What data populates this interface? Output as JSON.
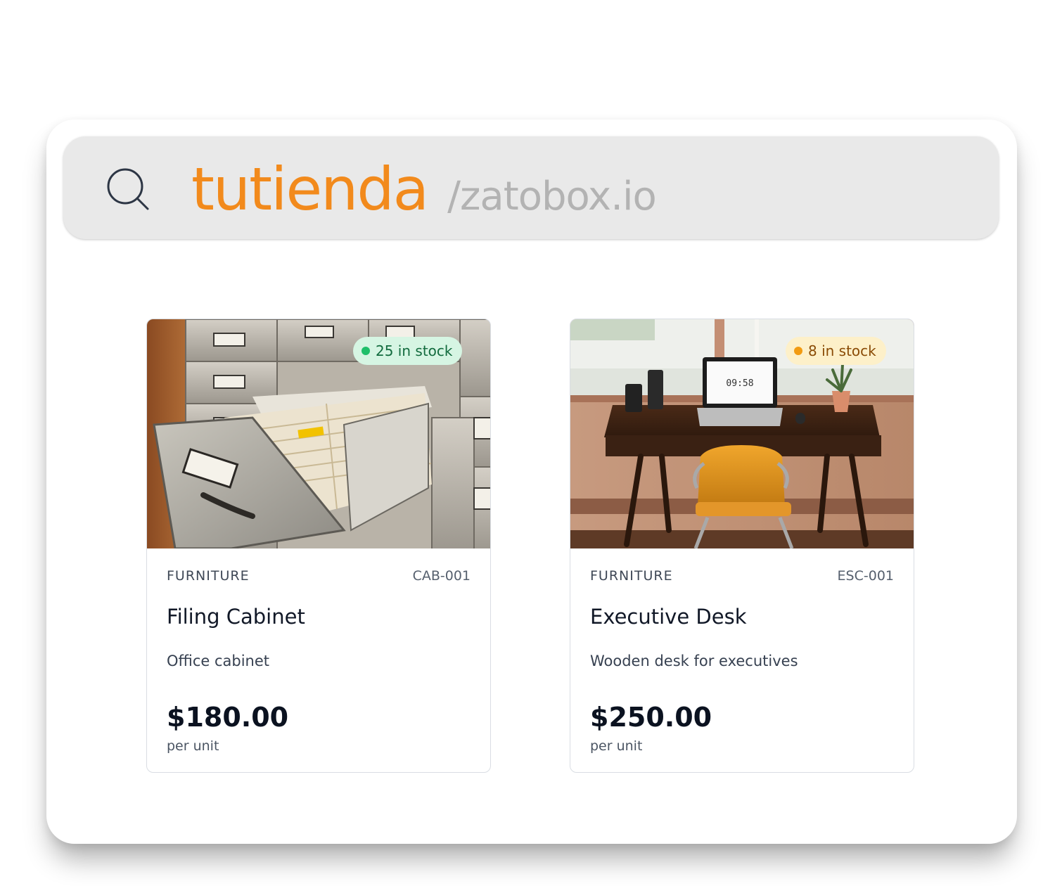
{
  "search_bar": {
    "brand": "tutienda",
    "domain": "/zatobox.io",
    "icon": "search-icon"
  },
  "products": [
    {
      "category": "FURNITURE",
      "sku": "CAB-001",
      "name": "Filing Cabinet",
      "description": "Office cabinet",
      "price": "$180.00",
      "unit": "per unit",
      "stock": "25 in stock",
      "stock_color": "#1fbf6a",
      "image": "filing-cabinet-photo"
    },
    {
      "category": "FURNITURE",
      "sku": "ESC-001",
      "name": "Executive Desk",
      "description": "Wooden desk for executives",
      "price": "$250.00",
      "unit": "per unit",
      "stock": "8 in stock",
      "stock_color": "#f29b11",
      "image": "executive-desk-photo",
      "laptop_clock": "09:58"
    }
  ],
  "colors": {
    "brand": "#f28a1c",
    "domain": "#b3b3b3",
    "search_bar_bg": "#e9e9e9"
  }
}
